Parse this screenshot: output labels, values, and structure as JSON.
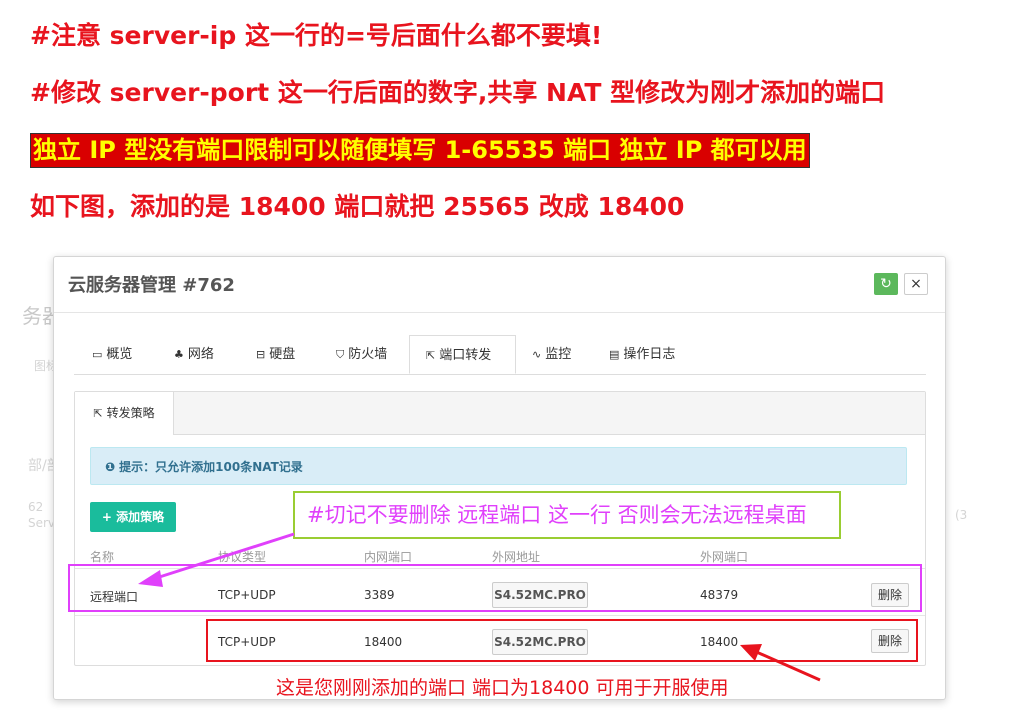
{
  "instructions": {
    "line1": "#注意 server-ip  这一行的=号后面什么都不要填!",
    "line2": "#修改 server-port  这一行后面的数字,共享 NAT 型修改为刚才添加的端口",
    "line3": "独立 IP 型没有端口限制可以随便填写  1-65535 端口  独立 IP 都可以用",
    "line4": "如下图，添加的是 18400  端口就把 25565  改成 18400"
  },
  "modal": {
    "title": "云服务器管理 #762",
    "refresh_icon": "↻",
    "close_icon": "×"
  },
  "tabs": [
    {
      "icon": "monitor-icon",
      "glyph": "▭",
      "label": "概览"
    },
    {
      "icon": "network-icon",
      "glyph": "♣",
      "label": "网络"
    },
    {
      "icon": "disk-icon",
      "glyph": "⊟",
      "label": "硬盘"
    },
    {
      "icon": "shield-icon",
      "glyph": "⛉",
      "label": "防火墙"
    },
    {
      "icon": "external-link-icon",
      "glyph": "⇱",
      "label": "端口转发"
    },
    {
      "icon": "pulse-icon",
      "glyph": "∿",
      "label": "监控"
    },
    {
      "icon": "file-icon",
      "glyph": "▤",
      "label": "操作日志"
    }
  ],
  "subtab": {
    "glyph": "⇱",
    "label": "转发策略"
  },
  "alert": {
    "glyph": "❶",
    "text": "提示：只允许添加100条NAT记录"
  },
  "add_button": "+ 添加策略",
  "table": {
    "headers": [
      "名称",
      "协议类型",
      "内网端口",
      "外网地址",
      "外网端口"
    ],
    "rows": [
      {
        "name": "远程端口",
        "protocol": "TCP+UDP",
        "internal": "3389",
        "host": "S4.52MC.PRO",
        "external": "48379",
        "action": "删除"
      },
      {
        "name": "",
        "protocol": "TCP+UDP",
        "internal": "18400",
        "host": "S4.52MC.PRO",
        "external": "18400",
        "action": "删除"
      }
    ]
  },
  "annotations": {
    "warning": "#切记不要删除 远程端口 这一行 否则会无法远程桌面",
    "note": "这是您刚刚添加的端口 端口为18400  可用于开服使用"
  },
  "ghost": {
    "title": "务器",
    "sel": "图标",
    "slash": "部/部",
    "num": "62",
    "label": "Serv",
    "paren": "(3"
  },
  "colors": {
    "red": "#e8141e",
    "pink": "#e040fb",
    "green": "#9acd32",
    "teal": "#1abc9c"
  }
}
